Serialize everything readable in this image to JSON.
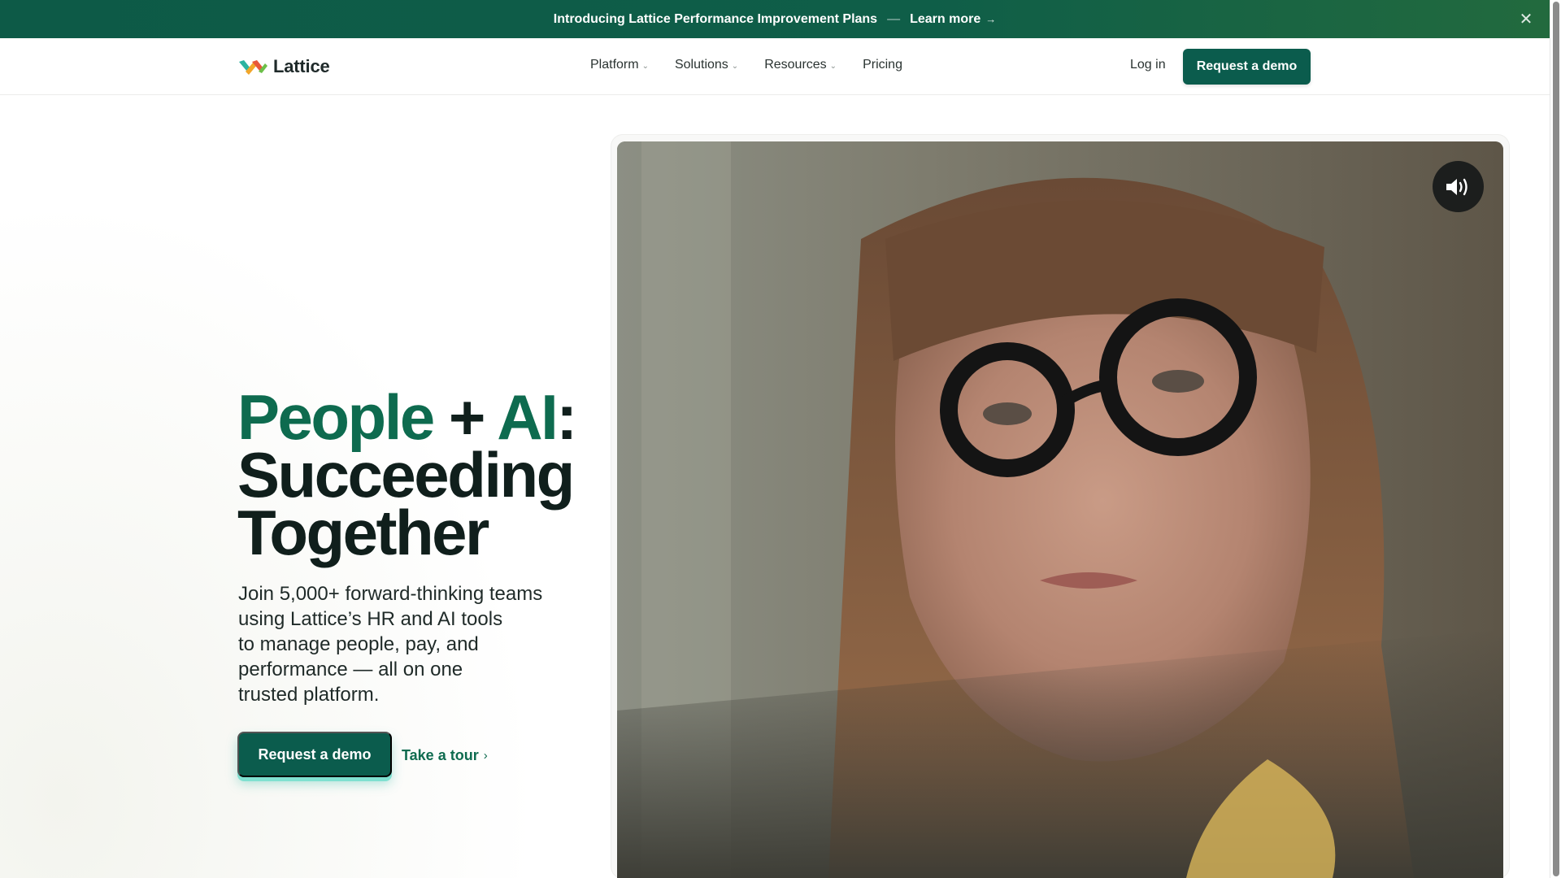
{
  "announcement": {
    "text": "Introducing Lattice Performance Improvement Plans",
    "separator": "—",
    "link_label": "Learn more",
    "link_arrow": "→",
    "close_label": "✕"
  },
  "header": {
    "brand": "Lattice",
    "nav": [
      {
        "label": "Platform",
        "has_dropdown": true
      },
      {
        "label": "Solutions",
        "has_dropdown": true
      },
      {
        "label": "Resources",
        "has_dropdown": true
      },
      {
        "label": "Pricing",
        "has_dropdown": false
      }
    ],
    "login_label": "Log in",
    "cta_label": "Request a demo"
  },
  "hero": {
    "headline_part1": "People",
    "headline_plus": " + ",
    "headline_part2": "AI",
    "headline_colon": ":",
    "headline_line2": "Succeeding",
    "headline_line3": "Together",
    "subcopy_lines": [
      "Join 5,000+ forward-thinking teams",
      "using Lattice’s HR and AI tools",
      "to manage people, pay, and",
      "performance — all on one",
      "trusted platform."
    ],
    "cta_label": "Request a demo",
    "tour_label": "Take a tour",
    "tour_chevron": "›"
  },
  "video": {
    "sound_icon": "speaker-volume-icon"
  },
  "colors": {
    "brand_green": "#0b5c4d",
    "headline_green": "#0e6b4f",
    "banner_green": "#0d5a47",
    "cta_glow": "#7fe0d0"
  }
}
